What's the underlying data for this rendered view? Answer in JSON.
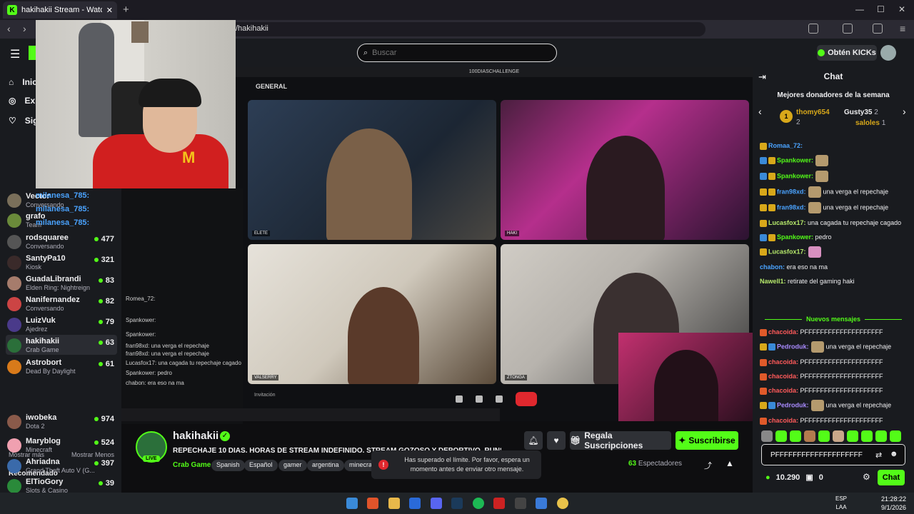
{
  "browser": {
    "tab_title": "hakihakii Stream - Watch Live",
    "url": "/hakihakii"
  },
  "header": {
    "search_placeholder": "Buscar",
    "kicks_button": "Obtén KICKs"
  },
  "sidebar": {
    "nav": [
      "Inicio",
      "Explorar",
      "Siguiendo"
    ],
    "following": [
      {
        "name": "Vector",
        "game": "Conversando",
        "viewers": "",
        "color": "#7a6f5a"
      },
      {
        "name": "grafo",
        "game": "Team",
        "viewers": "",
        "color": "#6a8a3a"
      },
      {
        "name": "rodsquaree",
        "game": "Conversando",
        "viewers": "477",
        "color": "#555"
      },
      {
        "name": "SantyPa10",
        "game": "Kiosk",
        "viewers": "321",
        "color": "#3a2a2a"
      },
      {
        "name": "GuadaLibrandi",
        "game": "Elden Ring: Nightreign",
        "viewers": "83",
        "color": "#a67c6c"
      },
      {
        "name": "Nanifernandez",
        "game": "Conversando",
        "viewers": "82",
        "color": "#c44"
      },
      {
        "name": "LuizVuk",
        "game": "Ajedrez",
        "viewers": "79",
        "color": "#4a3a8a"
      },
      {
        "name": "hakihakii",
        "game": "Crab Game",
        "viewers": "63",
        "color": "#2b6f3a"
      },
      {
        "name": "Astrobort",
        "game": "Dead By Daylight",
        "viewers": "61",
        "color": "#d87a1a"
      }
    ],
    "show_more": "Mostrar más",
    "show_less": "Mostrar Menos",
    "recommended_title": "Recomendado",
    "recommended": [
      {
        "name": "iwobeka",
        "game": "Dota 2",
        "viewers": "974",
        "color": "#8a5a4a"
      },
      {
        "name": "Maryblog",
        "game": "Minecraft",
        "viewers": "524",
        "color": "#f0a0b0"
      },
      {
        "name": "Ahriadna",
        "game": "Grand Theft Auto V (G...",
        "viewers": "397",
        "color": "#3a6aaa"
      },
      {
        "name": "ElTioGory",
        "game": "Slots & Casino",
        "viewers": "39",
        "color": "#2a8a3a"
      }
    ]
  },
  "overlay": {
    "names": [
      "milanesa_785:",
      "milanesa_785:",
      "milanesa_785:"
    ],
    "chat_lines": [
      "Romea_72:",
      "Spankower:",
      "Spankower:",
      "fran98xd: una verga el repechaje",
      "fran98xd: una verga el repechaje",
      "Lucasfox17: una cagada tu repechaje cagado",
      "Spankower: pedro",
      "chabon: era eso na ma"
    ]
  },
  "video": {
    "channel_label": "GENERAL",
    "top_title": "100DIASCHALLENGE",
    "tiles": [
      "ELETE",
      "HAKI",
      "VALSERRY",
      "ZTONGA"
    ],
    "invite_label": "Invitación"
  },
  "stream": {
    "name": "hakihakii",
    "live": "LIVE",
    "title": "REPECHAJE 10 DIAS. HORAS DE STREAM INDEFINIDO. STREAM GOZOSO Y DEPORTIVO. RUNS I...",
    "game": "Crab Game",
    "tags": [
      "Spanish",
      "Español",
      "gamer",
      "argentina",
      "minecraft"
    ],
    "gift_button": "Regala Suscripciones",
    "subscribe_button": "Suscribirse",
    "viewers_count": "63",
    "viewers_label": "Espectadores"
  },
  "toast": {
    "text": "Has superado el límite. Por favor, espera un momento antes de enviar otro mensaje."
  },
  "chat": {
    "title": "Chat",
    "donors_title": "Mejores donadores de la semana",
    "donors": [
      {
        "name": "thomy654",
        "count": "2"
      },
      {
        "name": "Gusty35",
        "count": "2"
      },
      {
        "name": "saloles",
        "count": "1"
      }
    ],
    "messages": [
      {
        "user": "Romaa_72:",
        "text": "",
        "color": "#4aa3ff"
      },
      {
        "user": "Spankower:",
        "text": "",
        "color": "#53fc18"
      },
      {
        "user": "Spankower:",
        "text": "",
        "color": "#53fc18"
      },
      {
        "user": "fran98xd:",
        "text": "una verga el repechaje",
        "color": "#4aa3ff"
      },
      {
        "user": "fran98xd:",
        "text": "una verga el repechaje",
        "color": "#4aa3ff"
      },
      {
        "user": "Lucasfox17:",
        "text": "una cagada tu repechaje cagado",
        "color": "#b6e96b"
      },
      {
        "user": "Spankower:",
        "text": "pedro",
        "color": "#53fc18"
      },
      {
        "user": "Lucasfox17:",
        "text": "",
        "color": "#b6e96b"
      },
      {
        "user": "chabon:",
        "text": "era eso na ma",
        "color": "#4aa3ff"
      },
      {
        "user": "Nawell1:",
        "text": "retirate del gaming haki",
        "color": "#b6e96b"
      }
    ],
    "new_messages": "Nuevos mensajes",
    "new": [
      {
        "user": "chacoida:",
        "text": "PFFFFFFFFFFFFFFFFFFFF",
        "color": "#ff5a5a"
      },
      {
        "user": "Pedroduk:",
        "text": "una verga el repechaje",
        "color": "#a98bff"
      },
      {
        "user": "chacoida:",
        "text": "PFFFFFFFFFFFFFFFFFFFF",
        "color": "#ff5a5a"
      },
      {
        "user": "chacoida:",
        "text": "PFFFFFFFFFFFFFFFFFFFF",
        "color": "#ff5a5a"
      },
      {
        "user": "chacoida:",
        "text": "PFFFFFFFFFFFFFFFFFFFF",
        "color": "#ff5a5a"
      },
      {
        "user": "Pedroduk:",
        "text": "una verga el repechaje",
        "color": "#a98bff"
      },
      {
        "user": "chacoida:",
        "text": "PFFFFFFFFFFFFFFFFFFFF",
        "color": "#ff5a5a"
      }
    ],
    "input_value": "PFFFFFFFFFFFFFFFFFFFF",
    "points": "10.290",
    "drops": "0",
    "send_button": "Chat"
  },
  "taskbar": {
    "lang1": "ESP",
    "lang2": "LAA",
    "time": "21:28:22",
    "date": "9/1/2026"
  }
}
